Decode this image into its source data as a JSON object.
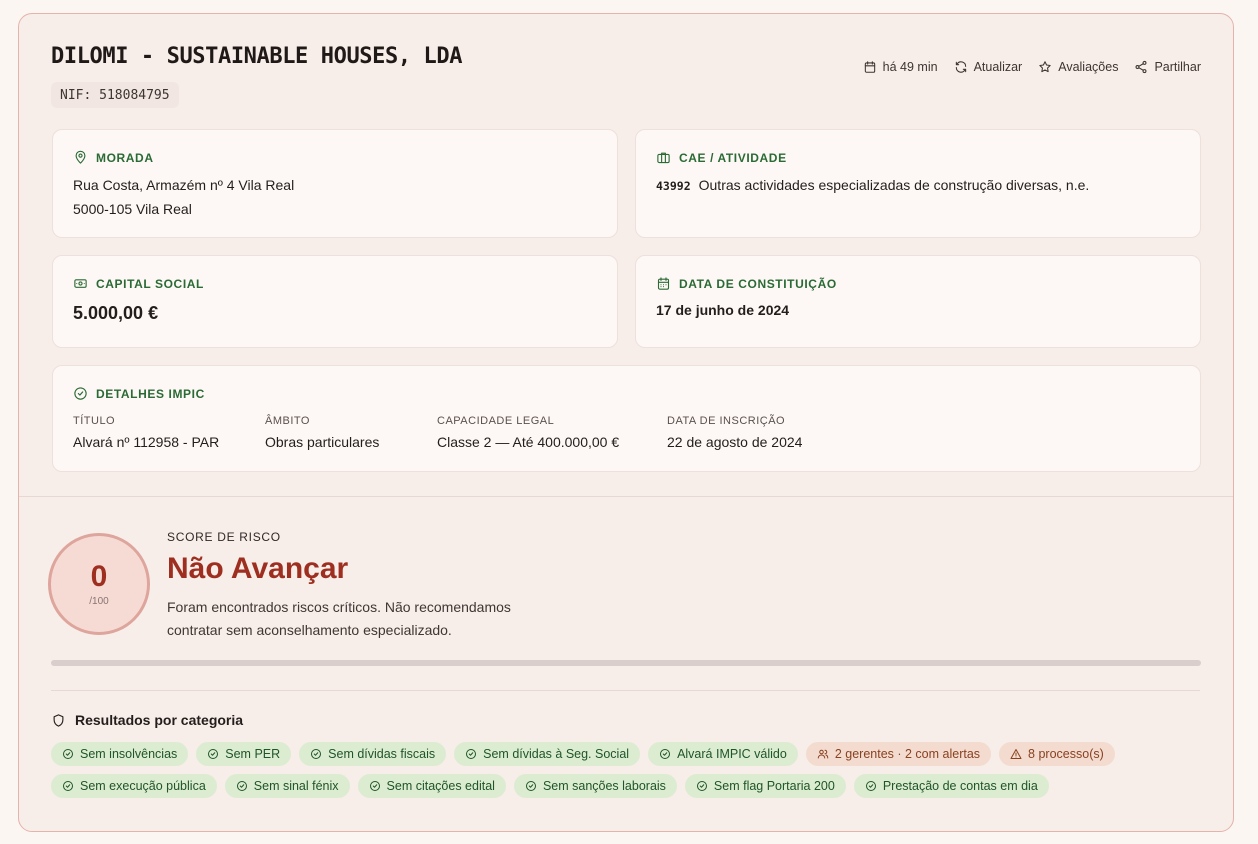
{
  "company": {
    "name": "DILOMI - SUSTAINABLE HOUSES, LDA",
    "nif": "NIF: 518084795"
  },
  "actions": [
    {
      "label": "há 49 min",
      "icon": "calendar-icon"
    },
    {
      "label": "Atualizar",
      "icon": "refresh-icon"
    },
    {
      "label": "Avaliações",
      "icon": "star-icon"
    },
    {
      "label": "Partilhar",
      "icon": "share-icon"
    }
  ],
  "morada": {
    "label": "MORADA",
    "line1": "Rua Costa, Armazém nº 4 Vila Real",
    "line2": "5000-105 Vila Real"
  },
  "cae": {
    "label": "CAE / ATIVIDADE",
    "code": "43992",
    "description": "Outras actividades especializadas de construção diversas, n.e."
  },
  "capital": {
    "label": "CAPITAL SOCIAL",
    "value": "5.000,00 €"
  },
  "constituicao": {
    "label": "DATA DE CONSTITUIÇÃO",
    "value": "17 de junho de 2024"
  },
  "impic": {
    "label": "DETALHES IMPIC",
    "fields": [
      {
        "key": "TÍTULO",
        "value": "Alvará nº 112958 - PAR"
      },
      {
        "key": "ÂMBITO",
        "value": "Obras particulares"
      },
      {
        "key": "CAPACIDADE LEGAL",
        "value": "Classe 2 — Até 400.000,00 €"
      },
      {
        "key": "DATA DE INSCRIÇÃO",
        "value": "22 de agosto de 2024"
      }
    ]
  },
  "score": {
    "label": "SCORE DE RISCO",
    "value": "0",
    "max": "/100",
    "progress": 0,
    "verdict": "Não Avançar",
    "description": "Foram encontrados riscos críticos. Não recomendamos contratar sem aconselhamento especializado.",
    "color": "#9e2f20"
  },
  "results": {
    "title": "Resultados por categoria",
    "chips": [
      {
        "label": "Sem insolvências",
        "status": "ok"
      },
      {
        "label": "Sem PER",
        "status": "ok"
      },
      {
        "label": "Sem dívidas fiscais",
        "status": "ok"
      },
      {
        "label": "Sem dívidas à Seg. Social",
        "status": "ok"
      },
      {
        "label": "Alvará IMPIC válido",
        "status": "ok"
      },
      {
        "label": "2 gerentes · 2 com alertas",
        "status": "warn-users"
      },
      {
        "label": "8 processo(s)",
        "status": "warn-alert"
      },
      {
        "label": "Sem execução pública",
        "status": "ok"
      },
      {
        "label": "Sem sinal fénix",
        "status": "ok"
      },
      {
        "label": "Sem citações edital",
        "status": "ok"
      },
      {
        "label": "Sem sanções laborais",
        "status": "ok"
      },
      {
        "label": "Sem flag Portaria 200",
        "status": "ok"
      },
      {
        "label": "Prestação de contas em dia",
        "status": "ok"
      }
    ]
  }
}
